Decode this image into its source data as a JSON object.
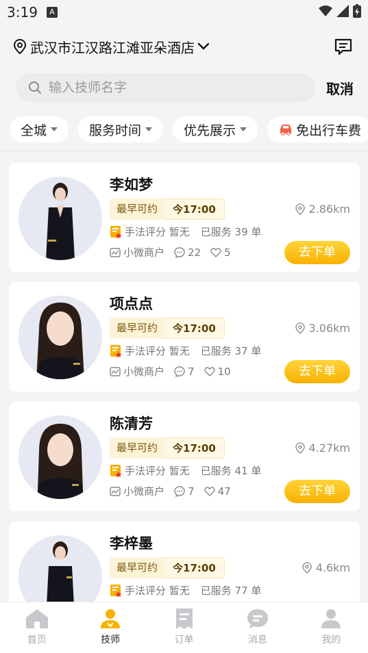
{
  "status": {
    "time": "3:19",
    "badge": "A"
  },
  "header": {
    "location": "武汉市江汉路江滩亚朵酒店"
  },
  "search": {
    "placeholder": "输入技师名字",
    "cancel_label": "取消"
  },
  "filters": [
    "全城",
    "服务时间",
    "优先展示",
    "免出行车费"
  ],
  "technicians": [
    {
      "name": "李如梦",
      "avail_label": "最早可约",
      "avail_time": "今17:00",
      "distance": "2.86km",
      "rating": "手法评分 暂无",
      "served": "已服务 39 单",
      "merchant": "小微商户",
      "comments": "22",
      "likes": "5",
      "order_label": "去下单"
    },
    {
      "name": "项点点",
      "avail_label": "最早可约",
      "avail_time": "今17:00",
      "distance": "3.06km",
      "rating": "手法评分 暂无",
      "served": "已服务 37 单",
      "merchant": "小微商户",
      "comments": "7",
      "likes": "10",
      "order_label": "去下单"
    },
    {
      "name": "陈清芳",
      "avail_label": "最早可约",
      "avail_time": "今17:00",
      "distance": "4.27km",
      "rating": "手法评分 暂无",
      "served": "已服务 41 单",
      "merchant": "小微商户",
      "comments": "7",
      "likes": "47",
      "order_label": "去下单"
    },
    {
      "name": "李梓墨",
      "avail_label": "最早可约",
      "avail_time": "今17:00",
      "distance": "4.6km",
      "rating": "手法评分 暂无",
      "served": "已服务 77 单",
      "merchant": "",
      "comments": "",
      "likes": "",
      "order_label": ""
    }
  ],
  "tabs": [
    {
      "label": "首页",
      "icon": "home-icon",
      "active": false
    },
    {
      "label": "技师",
      "icon": "technician-icon",
      "active": true
    },
    {
      "label": "订单",
      "icon": "order-icon",
      "active": false
    },
    {
      "label": "消息",
      "icon": "message-icon",
      "active": false
    },
    {
      "label": "我的",
      "icon": "profile-icon",
      "active": false
    }
  ],
  "colors": {
    "accent": "#f8b100",
    "background": "#f4f4f6"
  }
}
